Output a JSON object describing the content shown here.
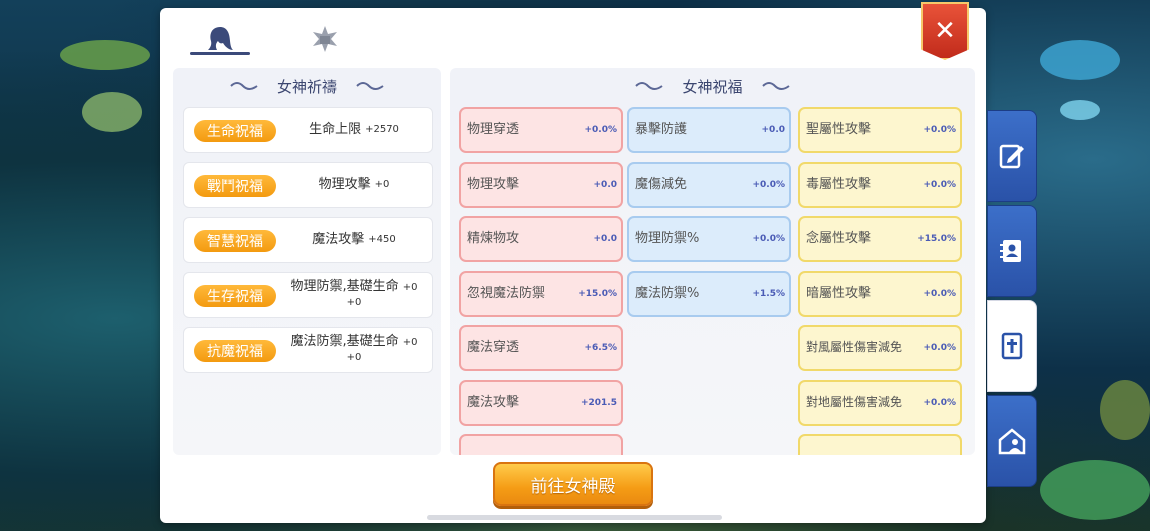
{
  "close_label": "✕",
  "left_section": {
    "title": "女神祈禱",
    "items": [
      {
        "tag": "生命祝福",
        "stat": "生命上限",
        "value": "+2570"
      },
      {
        "tag": "戰鬥祝福",
        "stat": "物理攻擊",
        "value": "+0"
      },
      {
        "tag": "智慧祝福",
        "stat": "魔法攻擊",
        "value": "+450"
      },
      {
        "tag": "生存祝福",
        "stat": "物理防禦,基礎生命",
        "value": "+0 +0"
      },
      {
        "tag": "抗魔祝福",
        "stat": "魔法防禦,基礎生命",
        "value": "+0 +0"
      }
    ]
  },
  "right_section": {
    "title": "女神祝福",
    "col1": [
      {
        "name": "物理穿透",
        "value": "+0.0%"
      },
      {
        "name": "物理攻擊",
        "value": "+0.0"
      },
      {
        "name": "精煉物攻",
        "value": "+0.0"
      },
      {
        "name": "忽視魔法防禦",
        "value": "+15.0%"
      },
      {
        "name": "魔法穿透",
        "value": "+6.5%"
      },
      {
        "name": "魔法攻擊",
        "value": "+201.5"
      }
    ],
    "col2": [
      {
        "name": "暴擊防護",
        "value": "+0.0"
      },
      {
        "name": "魔傷減免",
        "value": "+0.0%"
      },
      {
        "name": "物理防禦%",
        "value": "+0.0%"
      },
      {
        "name": "魔法防禦%",
        "value": "+1.5%"
      }
    ],
    "col3": [
      {
        "name": "聖屬性攻擊",
        "value": "+0.0%"
      },
      {
        "name": "毒屬性攻擊",
        "value": "+0.0%"
      },
      {
        "name": "念屬性攻擊",
        "value": "+15.0%"
      },
      {
        "name": "暗屬性攻擊",
        "value": "+0.0%"
      },
      {
        "name": "對風屬性傷害減免",
        "value": "+0.0%"
      },
      {
        "name": "對地屬性傷害減免",
        "value": "+0.0%"
      }
    ]
  },
  "go_button": "前往女神殿",
  "colors": {
    "accent_orange": "#f39a0f",
    "nav_blue": "#2a52a8",
    "close_red": "#d6391f"
  }
}
